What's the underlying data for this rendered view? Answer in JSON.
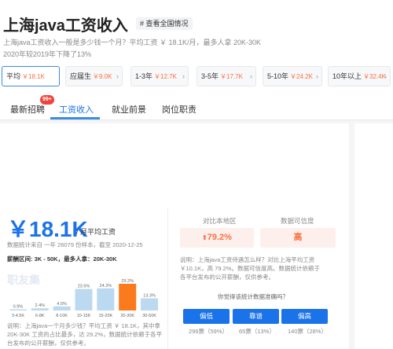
{
  "header": {
    "title": "上海java工资收入",
    "tag": "# 查看全国情况",
    "desc1": "上海java工资收入一般是多少钱一个月？平均工资 ￥ 18.1K/月，最多人拿 20K-30K",
    "desc2": "2020年较2019年下降了13%"
  },
  "filters": [
    {
      "label": "平均",
      "value": "￥18.1K",
      "chev": ""
    },
    {
      "label": "应届生",
      "value": "￥9.0K",
      "chev": "›"
    },
    {
      "label": "1-3年",
      "value": "￥12.7K",
      "chev": "›"
    },
    {
      "label": "3-5年",
      "value": "￥17.7K",
      "chev": "›"
    },
    {
      "label": "5-10年",
      "value": "￥24.2K",
      "chev": "›"
    },
    {
      "label": "10年以上",
      "value": "￥32.4K",
      "chev": "›"
    }
  ],
  "tabs": {
    "t1": "最新招聘",
    "badge": "99+",
    "t2": "工资收入",
    "t3": "就业前景",
    "t4": "岗位职责"
  },
  "salary": {
    "value": "￥18.1K",
    "unit": "/ 月平均工资",
    "stat": "数据统计来自 一年 26079 份样本，截至 2020-12-25",
    "range": "薪酬区间: 3K - 50K，最多人拿：20K-30K",
    "watermark": "职友集",
    "note": "说明：上海java一个月多少钱？平均工资 ￥ 18.1K，其中拿 20K-30K 工资的占比最多，达 29.2%，数据统计依赖于各平台发布的公开薪酬，仅供参考。"
  },
  "chart_data": {
    "type": "bar",
    "categories": [
      "3-4.5K",
      "6-8K",
      "8-10K",
      "10-15K",
      "15-20K",
      "20-30K",
      "30-50K"
    ],
    "values": [
      0.9,
      2.4,
      4.5,
      23.5,
      24.2,
      29.2,
      13.3
    ],
    "labels": [
      "0.9%",
      "2.4%",
      "4.5%",
      "23.5%",
      "24.2%",
      "29.2%",
      "13.3%"
    ],
    "highlight_index": 5,
    "colors": {
      "normal": "#bcd9f2",
      "highlight": "#fc7a1e"
    }
  },
  "compare": {
    "head1": "对比本地区",
    "head2": "数据可信度",
    "val1": "79.2%",
    "val2": "高",
    "note": "说明：上海java工资待遇怎么样？对比上海平均工资 ￥10.1K，高 79.2%。数据可信度高。数据统计依赖于各平台发布的公开薪酬，仅供参考。",
    "question": "你觉得该统计数据准确吗？",
    "votes": [
      {
        "label": "偏低",
        "count": "296票（59%）"
      },
      {
        "label": "靠谱",
        "count": "65票（13%）"
      },
      {
        "label": "偏高",
        "count": "140票（28%）"
      }
    ]
  }
}
